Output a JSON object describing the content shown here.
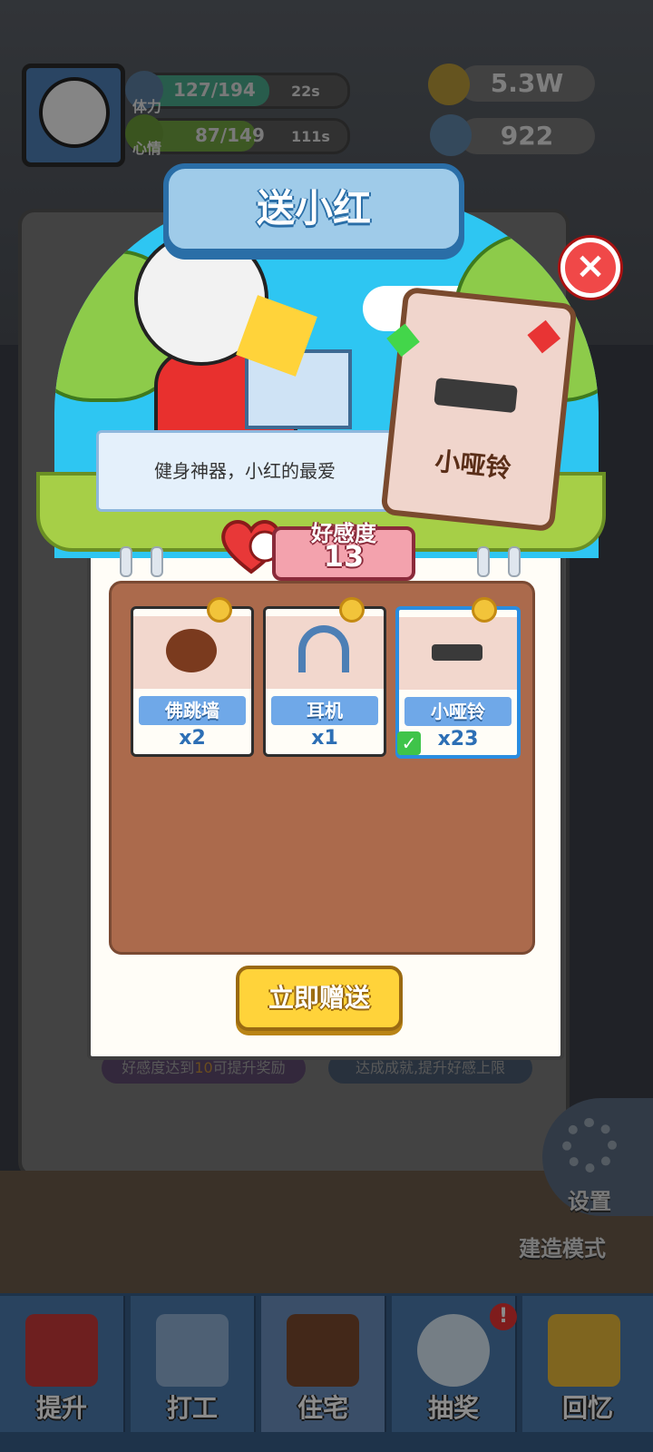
{
  "hud": {
    "stamina_label": "体力",
    "stamina_value": "127/194",
    "stamina_timer": "22s",
    "mood_label": "心情",
    "mood_value": "87/149",
    "mood_timer": "111s",
    "coins": "5.3W",
    "gems": "922"
  },
  "modal": {
    "title": "送小红",
    "speech": "健身神器，小红的最爱",
    "featured_item": "小哑铃",
    "favor_label": "好感度",
    "favor_value": "13",
    "items": [
      {
        "name": "佛跳墙",
        "qty": "x2",
        "selected": false
      },
      {
        "name": "耳机",
        "qty": "x1",
        "selected": false
      },
      {
        "name": "小哑铃",
        "qty": "x23",
        "selected": true
      }
    ],
    "send_button": "立即赠送"
  },
  "background": {
    "hint_left_prefix": "好感度达到",
    "hint_left_number": "10",
    "hint_left_suffix": "可提升奖励",
    "hint_right": "达成成就,提升好感上限",
    "settings_label": "设置",
    "build_mode_label": "建造模式"
  },
  "nav": [
    {
      "label": "提升"
    },
    {
      "label": "打工"
    },
    {
      "label": "住宅"
    },
    {
      "label": "抽奖"
    },
    {
      "label": "回忆"
    }
  ],
  "colors": {
    "accent_blue": "#2a6ea7",
    "send_yellow": "#ffd33a",
    "close_red": "#f04848",
    "favor_pink": "#f3a2ad"
  }
}
